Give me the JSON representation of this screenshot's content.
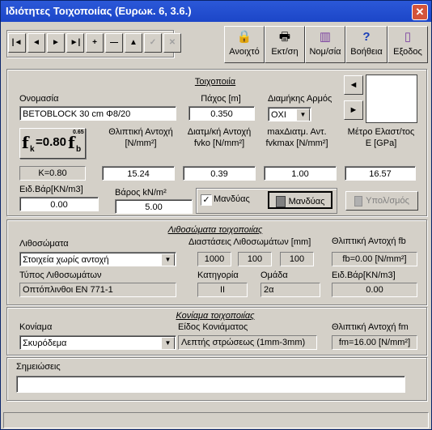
{
  "window": {
    "title": "Ιδιότητες Τοιχοποιίας (Ευρωκ. 6, 3.6.)",
    "close_glyph": "✕"
  },
  "nav_buttons": [
    {
      "name": "first-record-button",
      "glyph": "|◄"
    },
    {
      "name": "prev-record-button",
      "glyph": "◄"
    },
    {
      "name": "next-record-button",
      "glyph": "►"
    },
    {
      "name": "last-record-button",
      "glyph": "►|"
    },
    {
      "name": "add-record-button",
      "glyph": "+"
    },
    {
      "name": "delete-record-button",
      "glyph": "—"
    },
    {
      "name": "edit-record-button",
      "glyph": "▲"
    },
    {
      "name": "post-record-button",
      "glyph": "✓"
    },
    {
      "name": "cancel-record-button",
      "glyph": "✕"
    }
  ],
  "toolbar": [
    {
      "name": "open-button",
      "icon": "padlock-icon",
      "glyph": "🔒",
      "label": "Ανοιχτό"
    },
    {
      "name": "print-button",
      "icon": "printer-icon",
      "glyph": "🖶",
      "label": "Εκτ/ση"
    },
    {
      "name": "standards-button",
      "icon": "books-icon",
      "glyph": "▥",
      "label": "Νομ/σία"
    },
    {
      "name": "help-button",
      "icon": "question-icon",
      "glyph": "?",
      "label": "Βοήθεια"
    },
    {
      "name": "exit-button",
      "icon": "exit-door-icon",
      "glyph": "▯",
      "label": "Εξοδος"
    }
  ],
  "masonry": {
    "section_title": "Τοιχοποιία",
    "name_label": "Ονομασία",
    "name_value": "BETOBLOCK 30 cm Φ8/20",
    "thickness_label": "Πάχος [m]",
    "thickness_value": "0.350",
    "joint_label": "Διαμήκης Αρμός",
    "joint_value": "ΟΧΙ",
    "formula_label": "fk=0.80fb^0.65",
    "formula_main": "f",
    "formula_sub_k": "k",
    "formula_eq": "=0.80",
    "formula_f": "f",
    "formula_sub_b": "b",
    "formula_exp": "0.65",
    "compressive_label_1": "Θλιπτική Αντοχή",
    "compressive_label_2": "[N/mm²]",
    "compressive_value": "15.24",
    "shear_label_1": "Διατμ/κή Αντοχή",
    "shear_label_2": "fvko [N/mm²]",
    "shear_value": "0.39",
    "maxshear_label_1": "maxΔιατμ. Αντ.",
    "maxshear_label_2": "fvkmax [N/mm²]",
    "maxshear_value": "1.00",
    "modulus_label_1": "Μέτρο Ελαστ/τος",
    "modulus_label_2": "E [GPa]",
    "modulus_value": "16.57",
    "k_value": "K=0.80",
    "unit_weight_label": "Ειδ.Βάρ[KN/m3]",
    "unit_weight_value": "0.00",
    "jacket_weight_label": "Βάρος kN/m²",
    "jacket_weight_value": "5.00",
    "jacket_check_label": "Μανδύας",
    "jacket_check_mark": "✓",
    "jacket_button_label": "Μανδύας",
    "calc_button_label": "Υπολ/σμός"
  },
  "units": {
    "section_title": "Λιθοσώματα τοιχοποιίας",
    "type_label": "Λιθοσώματα",
    "type_value": "Στοιχεία χωρίς αντοχή",
    "dims_label": "Διαστάσεις Λιθοσωμάτων [mm]",
    "dims": [
      "1000",
      "100",
      "100"
    ],
    "fb_label": "Θλιπτική Αντοχή fb",
    "fb_value": "fb=0.00 [N/mm²]",
    "kind_label": "Τύπος Λιθοσωμάτων",
    "kind_value": "Οπτόπλινθοι ΕΝ 771-1",
    "category_label": "Κατηγορία",
    "category_value": "II",
    "group_label": "Ομάδα",
    "group_value": "2α",
    "weight_label": "Ειδ.Βάρ[KN/m3]",
    "weight_value": "0.00"
  },
  "mortar": {
    "section_title": "Κονίαμα τοιχοποιίας",
    "type_label": "Κονίαμα",
    "type_value": "Σκυρόδεμα",
    "kind_label": "Είδος Κονιάματος",
    "kind_value": "Λεπτής στρώσεως (1mm-3mm)",
    "fm_label": "Θλιπτική Αντοχή fm",
    "fm_value": "fm=16.00 [N/mm²]"
  },
  "notes": {
    "label": "Σημειώσεις",
    "value": ""
  },
  "side_buttons": {
    "left": "◄",
    "right": "►"
  },
  "combo_arrow": "▼"
}
